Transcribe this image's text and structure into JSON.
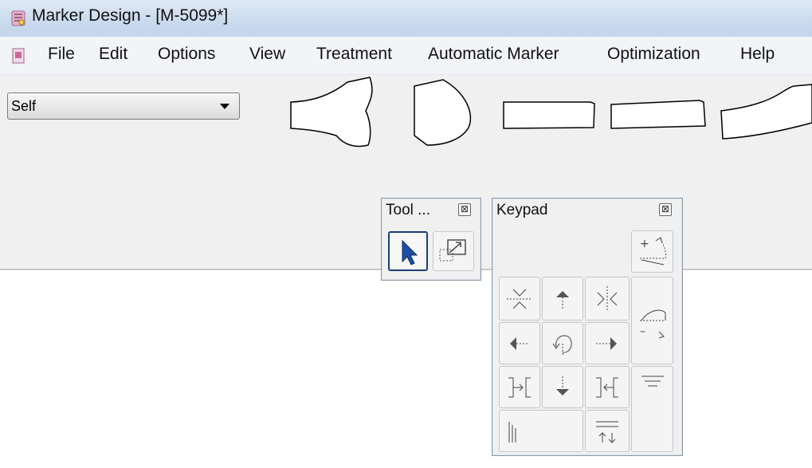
{
  "window": {
    "title": "Marker Design - [M-5099*]"
  },
  "menu": [
    "File",
    "Edit",
    "Options",
    "View",
    "Treatment",
    "Automatic Marker",
    "Optimization",
    "Help"
  ],
  "fabric_select": {
    "value": "Self"
  },
  "tool_panel": {
    "title": "Tool ...",
    "close_label": "⊠"
  },
  "keypad": {
    "title": "Keypad",
    "close_label": "⊠"
  }
}
